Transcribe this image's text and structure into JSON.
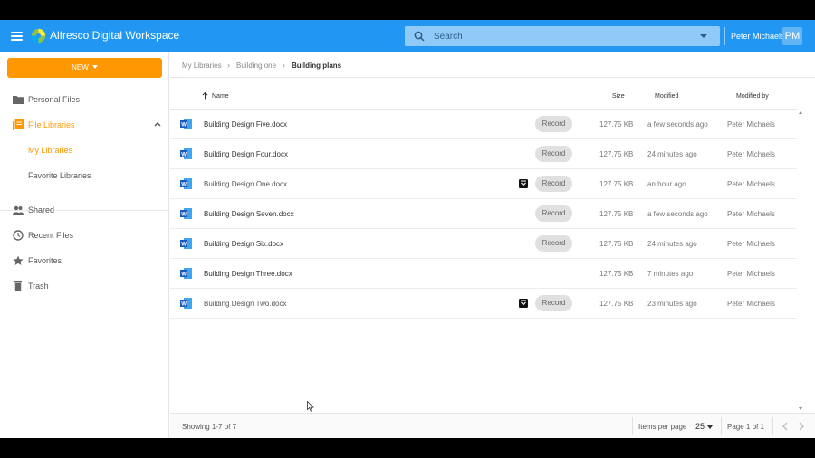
{
  "header": {
    "app_title": "Alfresco Digital Workspace",
    "search_placeholder": "Search",
    "user_name": "Peter Michaels",
    "user_initials": "PM",
    "color": "#2196f3"
  },
  "sidebar": {
    "new_label": "NEW",
    "new_color": "#ff9800",
    "items": [
      {
        "label": "Personal Files",
        "icon": "folder-icon"
      },
      {
        "label": "File Libraries",
        "icon": "library-icon"
      },
      {
        "label": "My Libraries",
        "icon": ""
      },
      {
        "label": "Favorite Libraries",
        "icon": ""
      },
      {
        "label": "Shared",
        "icon": "people-icon"
      },
      {
        "label": "Recent Files",
        "icon": "clock-icon"
      },
      {
        "label": "Favorites",
        "icon": "star-icon"
      },
      {
        "label": "Trash",
        "icon": "trash-icon"
      }
    ]
  },
  "breadcrumb": [
    "My Libraries",
    "Building one",
    "Building plans"
  ],
  "table": {
    "columns": {
      "name": "Name",
      "size": "Size",
      "modified": "Modified",
      "modified_by": "Modified by"
    },
    "rows": [
      {
        "name": "Building Design Five.docx",
        "record": "Record",
        "locked": false,
        "size": "127.75 KB",
        "modified": "a few seconds ago",
        "modified_by": "Peter Michaels"
      },
      {
        "name": "Building Design Four.docx",
        "record": "Record",
        "locked": false,
        "size": "127.75 KB",
        "modified": "24 minutes ago",
        "modified_by": "Peter Michaels"
      },
      {
        "name": "Building Design One.docx",
        "record": "Record",
        "locked": true,
        "size": "127.75 KB",
        "modified": "an hour ago",
        "modified_by": "Peter Michaels"
      },
      {
        "name": "Building Design Seven.docx",
        "record": "Record",
        "locked": false,
        "size": "127.75 KB",
        "modified": "a few seconds ago",
        "modified_by": "Peter Michaels"
      },
      {
        "name": "Building Design Six.docx",
        "record": "Record",
        "locked": false,
        "size": "127.75 KB",
        "modified": "24 minutes ago",
        "modified_by": "Peter Michaels"
      },
      {
        "name": "Building Design Three.docx",
        "record": "",
        "locked": false,
        "size": "127.75 KB",
        "modified": "7 minutes ago",
        "modified_by": "Peter Michaels"
      },
      {
        "name": "Building Design Two.docx",
        "record": "Record",
        "locked": true,
        "size": "127.75 KB",
        "modified": "23 minutes ago",
        "modified_by": "Peter Michaels"
      }
    ]
  },
  "pagination": {
    "showing": "Showing 1-7 of 7",
    "items_per_page_label": "Items per page",
    "items_per_page": "25",
    "page_label": "Page 1 of 1"
  }
}
